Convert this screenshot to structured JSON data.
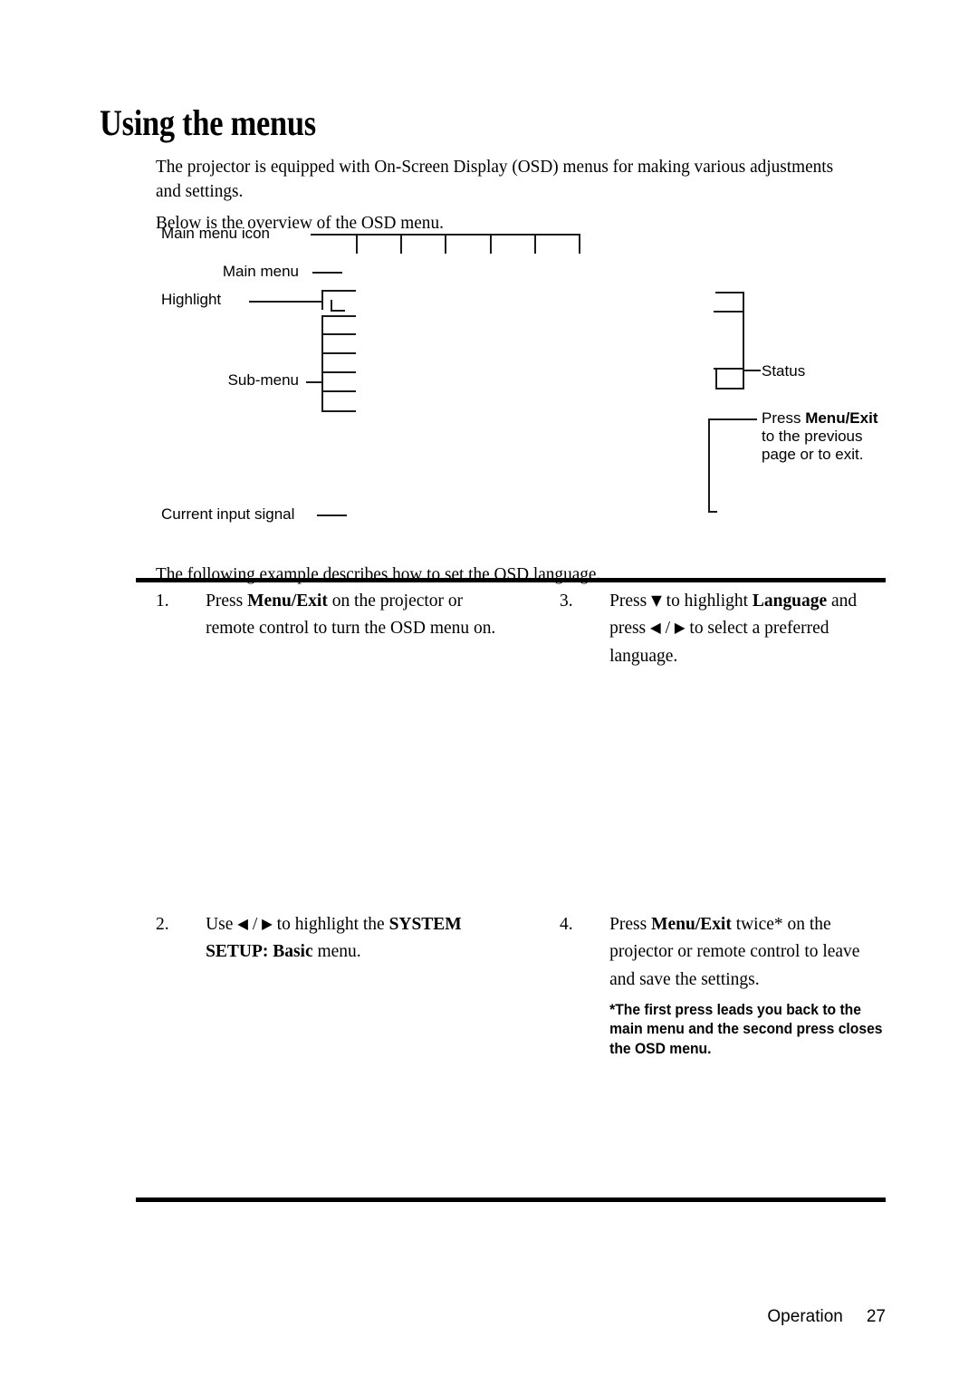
{
  "page": {
    "title": "Using the menus",
    "intro_paragraph_1": "The projector is equipped with On-Screen Display (OSD) menus for making various adjustments and settings.",
    "intro_paragraph_2": "Below is the overview of the OSD menu.",
    "example_intro": "The following example describes how to set the OSD language."
  },
  "diagram": {
    "labels": {
      "main_menu_icon": "Main menu icon",
      "main_menu": "Main menu",
      "highlight": "Highlight",
      "sub_menu": "Sub-menu",
      "current_input_signal": "Current input signal",
      "status": "Status"
    },
    "press_menu_note": {
      "lead": "Press ",
      "bold_1": "Menu/",
      "bold_2": "Exit",
      "tail": " to the previous page or to exit."
    }
  },
  "steps": [
    {
      "number": "1.",
      "text_before": "Press ",
      "bold": "Menu/Exit",
      "text_after": " on the projector or remote control to turn the OSD menu on."
    },
    {
      "number": "2.",
      "text_before": "Use ",
      "arrow_left": "◀",
      "arrow_sep": " / ",
      "arrow_right": "▶",
      "text_mid": " to highlight the ",
      "bold": "SYSTEM SETUP: Basic",
      "text_after": " menu."
    },
    {
      "number": "3.",
      "text_before": "Press ",
      "arrow_down": "▼",
      "text_mid": " to highlight ",
      "bold": "Language",
      "text_mid_2": " and press ",
      "arrow_left": "◀",
      "arrow_sep": " / ",
      "arrow_right": "▶",
      "text_after": " to select a preferred language."
    },
    {
      "number": "4.",
      "text_before": "Press ",
      "bold": "Menu/Exit",
      "text_after": " twice* on the projector or remote control to leave and save the settings.",
      "note": "*The first press leads you back to the main menu and the second press closes the OSD menu."
    }
  ],
  "footer": {
    "section": "Operation",
    "page_number": "27"
  },
  "colors": {
    "ink": "#000000",
    "line": "#1a1a1a",
    "page_background": "#ffffff"
  }
}
